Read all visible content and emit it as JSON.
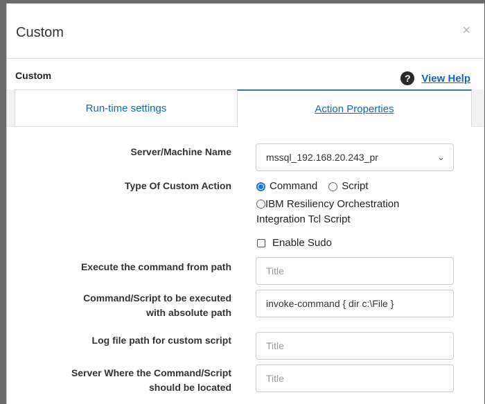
{
  "dialog": {
    "title": "Custom",
    "close_glyph": "×"
  },
  "section": {
    "title": "Custom",
    "help_icon": "?",
    "help_link": "View Help"
  },
  "tabs": [
    {
      "label": "Run-time settings",
      "active": false
    },
    {
      "label": "Action Properties",
      "active": true
    }
  ],
  "form": {
    "server_label": "Server/Machine Name",
    "server_value": "mssql_192.168.20.243_pr",
    "action_type_label": "Type Of Custom Action",
    "option_command": "Command",
    "option_script": "Script",
    "option_tcl_line1": "IBM Resiliency Orchestration",
    "option_tcl_line2": "Integration Tcl Script",
    "selected_option": "Command",
    "enable_sudo_label": "Enable Sudo",
    "enable_sudo_checked": false,
    "exec_path_label": "Execute the command from path",
    "exec_path_placeholder": "Title",
    "command_label_line1": "Command/Script to be executed",
    "command_label_line2": "with absolute path",
    "command_value": "invoke-command { dir c:\\File }",
    "log_path_label": "Log file path for custom script",
    "log_path_placeholder": "Title",
    "server_location_label_line1": "Server Where the Command/Script",
    "server_location_label_line2": "should be located",
    "server_location_placeholder": "Title"
  },
  "colors": {
    "accent": "#1565c0",
    "tab_active_border": "#2f78c4",
    "radio_selected": "#1a73e8"
  }
}
